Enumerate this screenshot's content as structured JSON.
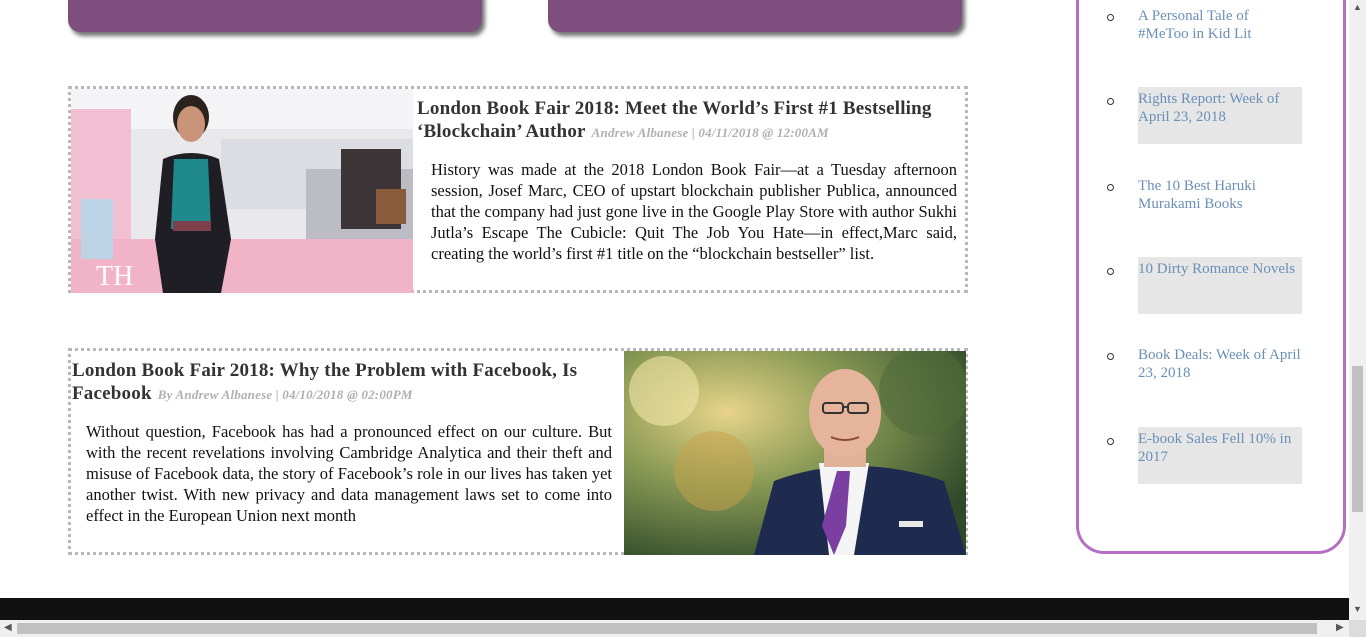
{
  "articles": [
    {
      "title": "London Book Fair 2018: Meet the World’s First #1 Bestselling ‘Blockchain’ Author",
      "byline": "Andrew Albanese | 04/11/2018 @ 12:00AM",
      "excerpt": "History was made at the 2018 London Book Fair—at a Tuesday afternoon session, Josef Marc, CEO of upstart blockchain publisher Publica, announced that the company had just gone live in the Google Play Store with author Sukhi Jutla’s Escape The Cubicle: Quit The Job You Hate—in effect,Marc said, creating the world’s first #1 title on the “blockchain bestseller” list.",
      "photo_sign_text": "TH"
    },
    {
      "title": "London Book Fair 2018: Why the Problem with Facebook, Is Facebook",
      "byline": "By Andrew Albanese | 04/10/2018 @ 02:00PM",
      "excerpt": "Without question, Facebook has had a pronounced effect on our culture. But with the recent revelations involving Cambridge Analytica and their theft and misuse of Facebook data, the story of Facebook’s role in our lives has taken yet another twist. With new privacy and data management laws set to come into effect in the European Union next month"
    }
  ],
  "sidebar": {
    "items": [
      {
        "label": "A Personal Tale of #MeToo in Kid Lit"
      },
      {
        "label": "Rights Report: Week of April 23, 2018"
      },
      {
        "label": "The 10 Best Haruki Murakami Books"
      },
      {
        "label": "10 Dirty Romance Novels"
      },
      {
        "label": "Book Deals: Week of April 23, 2018"
      },
      {
        "label": "E-book Sales Fell 10% in 2017"
      }
    ]
  },
  "colors": {
    "card_purple": "#7e4f7e",
    "sidebar_border": "#b46fc5",
    "link_blue": "#6a8fb8",
    "footer": "#111111"
  },
  "icons": {
    "scroll_up": "triangle-up-icon",
    "scroll_down": "triangle-down-icon",
    "scroll_left": "triangle-left-icon",
    "scroll_right": "triangle-right-icon"
  }
}
